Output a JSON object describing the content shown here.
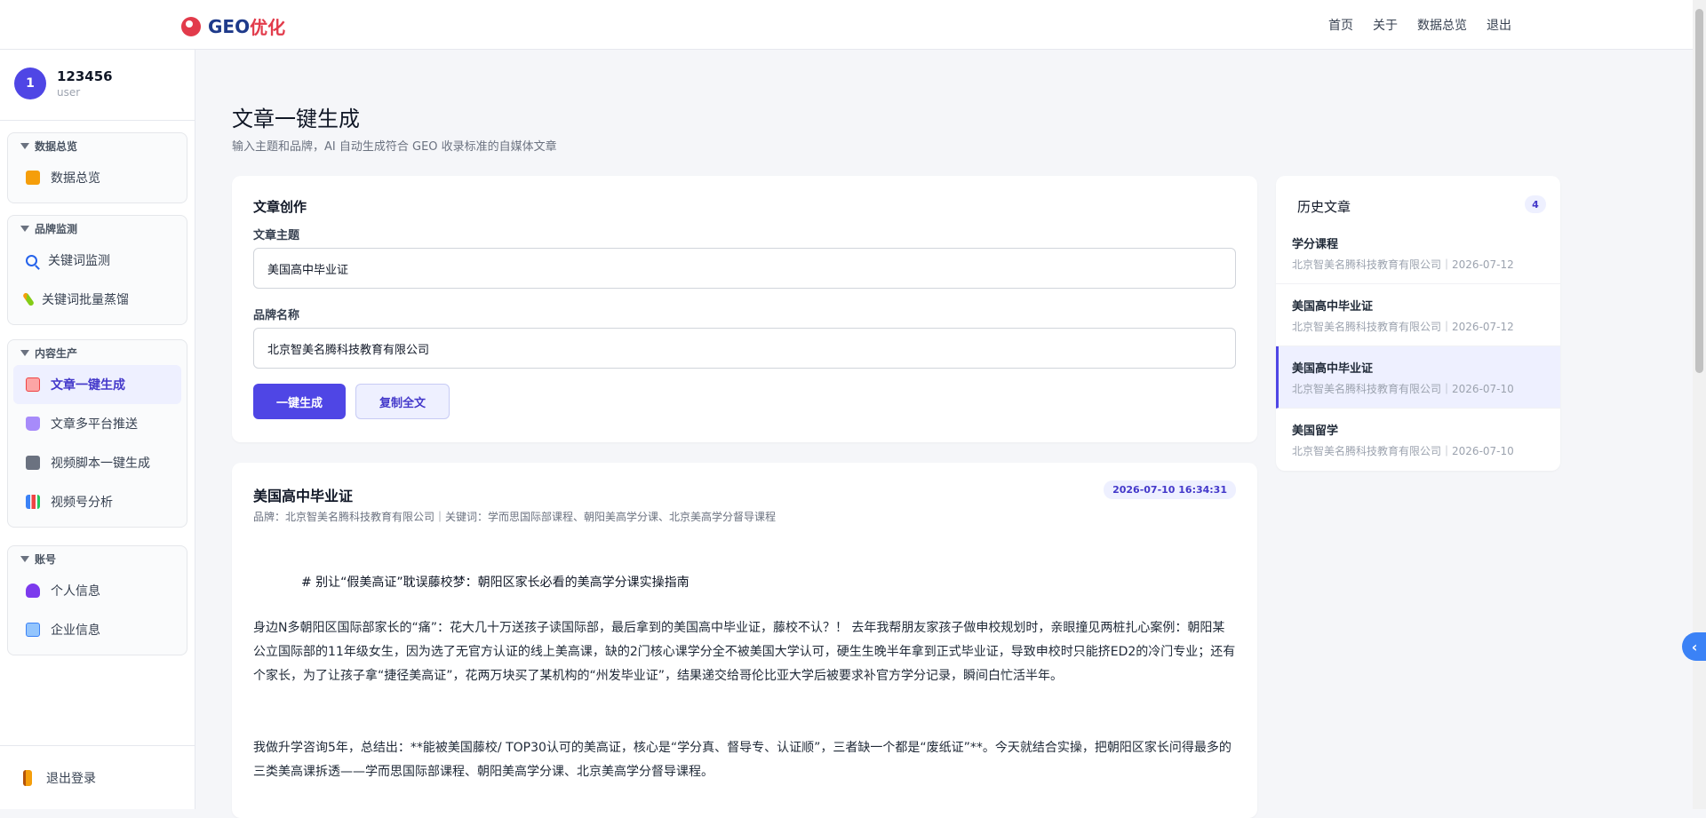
{
  "header": {
    "brand_part1": "GEO",
    "brand_part2": "优化",
    "nav": [
      "首页",
      "关于",
      "数据总览",
      "退出"
    ]
  },
  "user": {
    "avatar": "1",
    "name": "123456",
    "role": "user"
  },
  "sidebar": {
    "groups": [
      {
        "title": "数据总览",
        "items": [
          {
            "label": "数据总览",
            "icon": "overview-icon"
          }
        ]
      },
      {
        "title": "品牌监测",
        "items": [
          {
            "label": "关键词监测",
            "icon": "search-icon"
          },
          {
            "label": "关键词批量蒸馏",
            "icon": "wand-icon"
          }
        ]
      },
      {
        "title": "内容生产",
        "items": [
          {
            "label": "文章一键生成",
            "icon": "article-icon"
          },
          {
            "label": "文章多平台推送",
            "icon": "push-icon"
          },
          {
            "label": "视频脚本一键生成",
            "icon": "video-icon"
          },
          {
            "label": "视频号分析",
            "icon": "chart-icon"
          }
        ]
      },
      {
        "title": "账号",
        "items": [
          {
            "label": "个人信息",
            "icon": "person-icon"
          },
          {
            "label": "企业信息",
            "icon": "company-icon"
          }
        ]
      }
    ],
    "logout": "退出登录"
  },
  "page": {
    "title": "文章一键生成",
    "subtitle": "输入主题和品牌，AI 自动生成符合 GEO 收录标准的自媒体文章"
  },
  "create": {
    "title": "文章创作",
    "topic_label": "文章主题",
    "topic_value": "美国高中毕业证",
    "brand_label": "品牌名称",
    "brand_value": "北京智美名腾科技教育有限公司",
    "generate_btn": "一键生成",
    "copy_btn": "复制全文"
  },
  "article": {
    "title": "美国高中毕业证",
    "time": "2026-07-10 16:34:31",
    "meta": "品牌：北京智美名腾科技教育有限公司｜关键词：学而思国际部课程、朝阳美高学分课、北京美高学分督导课程",
    "heading": "# 别让“假美高证”耽误藤校梦：朝阳区家长必看的美高学分课实操指南",
    "para1": "身边N多朝阳区国际部家长的“痛”：花大几十万送孩子读国际部，最后拿到的美国高中毕业证，藤校不认？！ 去年我帮朋友家孩子做申校规划时，亲眼撞见两桩扎心案例：朝阳某公立国际部的11年级女生，因为选了无官方认证的线上美高课，缺的2门核心课学分全不被美国大学认可，硬生生晚半年拿到正式毕业证，导致申校时只能挤ED2的冷门专业；还有个家长，为了让孩子拿“捷径美高证”，花两万块买了某机构的“州发毕业证”，结果递交给哥伦比亚大学后被要求补官方学分记录，瞬间白忙活半年。",
    "para2": "我做升学咨询5年，总结出：**能被美国藤校/ TOP30认可的美高证，核心是“学分真、督导专、认证顺”，三者缺一个都是“废纸证”**。今天就结合实操，把朝阳区家长问得最多的三类美高课拆透——学而思国际部课程、朝阳美高学分课、北京美高学分督导课程。"
  },
  "history": {
    "title": "历史文章",
    "count": "4",
    "items": [
      {
        "title": "学分课程",
        "brand": "北京智美名腾科技教育有限公司",
        "date": "2026-07-12"
      },
      {
        "title": "美国高中毕业证",
        "brand": "北京智美名腾科技教育有限公司",
        "date": "2026-07-12"
      },
      {
        "title": "美国高中毕业证",
        "brand": "北京智美名腾科技教育有限公司",
        "date": "2026-07-10"
      },
      {
        "title": "美国留学",
        "brand": "北京智美名腾科技教育有限公司",
        "date": "2026-07-10"
      }
    ]
  },
  "float_tab": "‹",
  "meta_sep": "｜"
}
